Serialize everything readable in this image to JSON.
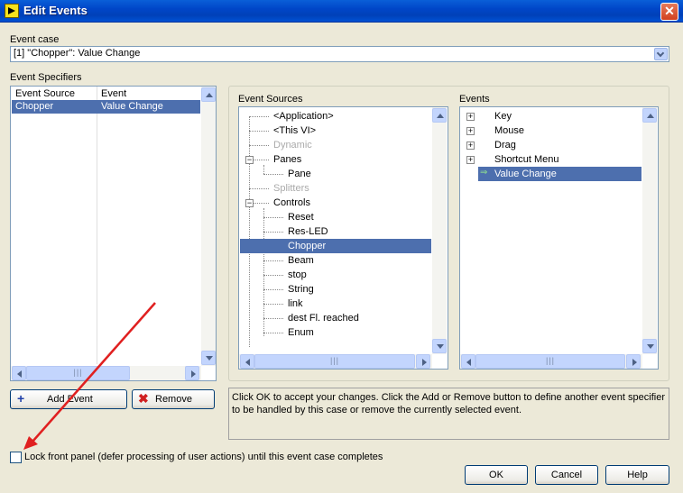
{
  "window": {
    "title": "Edit Events",
    "close_glyph": "✕"
  },
  "event_case": {
    "label": "Event case",
    "value": "[1] \"Chopper\": Value Change"
  },
  "event_specifiers": {
    "label": "Event Specifiers",
    "col_source": "Event Source",
    "col_event": "Event",
    "rows": [
      {
        "source": "Chopper",
        "event": "Value Change"
      }
    ]
  },
  "event_sources": {
    "label": "Event Sources",
    "items": [
      {
        "text": "<Application>",
        "dim": false
      },
      {
        "text": "<This VI>",
        "dim": false
      },
      {
        "text": "Dynamic",
        "dim": true
      },
      {
        "text": "Panes",
        "dim": false
      },
      {
        "text": "Pane",
        "dim": false
      },
      {
        "text": "Splitters",
        "dim": true
      },
      {
        "text": "Controls",
        "dim": false
      },
      {
        "text": "Reset",
        "dim": false
      },
      {
        "text": "Res-LED",
        "dim": false
      },
      {
        "text": "Chopper",
        "dim": false
      },
      {
        "text": "Beam",
        "dim": false
      },
      {
        "text": "stop",
        "dim": false
      },
      {
        "text": "String",
        "dim": false
      },
      {
        "text": "link",
        "dim": false
      },
      {
        "text": "dest Fl. reached",
        "dim": false
      },
      {
        "text": "Enum",
        "dim": false
      }
    ]
  },
  "events": {
    "label": "Events",
    "items": [
      "Key",
      "Mouse",
      "Drag",
      "Shortcut Menu",
      "Value Change"
    ]
  },
  "buttons": {
    "add_event": "Add Event",
    "remove": "Remove",
    "ok": "OK",
    "cancel": "Cancel",
    "help": "Help"
  },
  "info_text": "Click OK to accept your changes.  Click the Add or Remove button to define another event specifier to be handled by this case or remove the currently selected event.",
  "lock_checkbox": {
    "label": "Lock front panel (defer processing of user actions) until this event case completes",
    "checked": false
  },
  "colors": {
    "selection": "#4d6fae",
    "accent_arrow": "#e02020",
    "titlebar": "#0046c8"
  }
}
